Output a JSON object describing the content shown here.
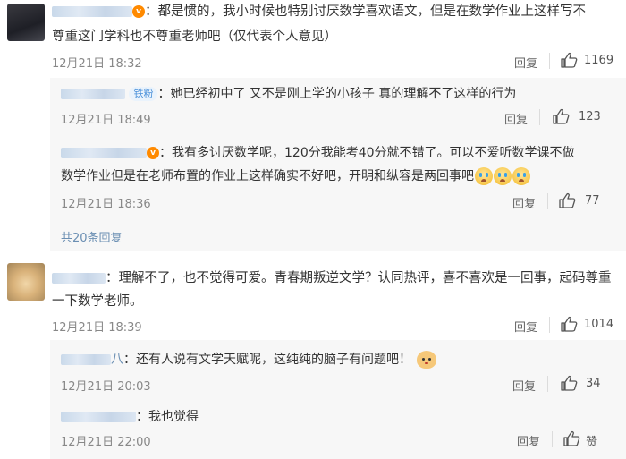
{
  "comments": [
    {
      "text_line1": "：都是惯的，我小时候也特别讨厌数学喜欢语文，但是在数学作业上这样写不",
      "text_line2": "尊重这门学科也不尊重老师吧（仅代表个人意见）",
      "timestamp": "12月21日 18:32",
      "reply_label": "回复",
      "likes": "1169",
      "replies": [
        {
          "badge": "铁粉",
          "text": "：她已经初中了 又不是刚上学的小孩子 真的理解不了这样的行为",
          "timestamp": "12月21日 18:49",
          "reply_label": "回复",
          "likes": "123"
        },
        {
          "text_line1": "：我有多讨厌数学呢，120分我能考40分就不错了。可以不爱听数学课不做",
          "text_line2": "数学作业但是在老师布置的作业上这样确实不好吧，开明和纵容是两回事吧",
          "timestamp": "12月21日 18:36",
          "reply_label": "回复",
          "likes": "77"
        }
      ],
      "more_replies": "共20条回复"
    },
    {
      "text_line1": "：理解不了，也不觉得可爱。青春期叛逆文学？认同热评，喜不喜欢是一回事，起码尊重",
      "text_line2": "一下数学老师。",
      "timestamp": "12月21日 18:39",
      "reply_label": "回复",
      "likes": "1014",
      "replies": [
        {
          "name_suffix": "八",
          "text": "：还有人说有文学天赋呢，这纯纯的脑子有问题吧！",
          "timestamp": "12月21日 20:03",
          "reply_label": "回复",
          "likes": "34"
        },
        {
          "text": "：我也觉得",
          "timestamp": "12月21日 22:00",
          "reply_label": "回复",
          "likes": "赞"
        }
      ]
    }
  ]
}
